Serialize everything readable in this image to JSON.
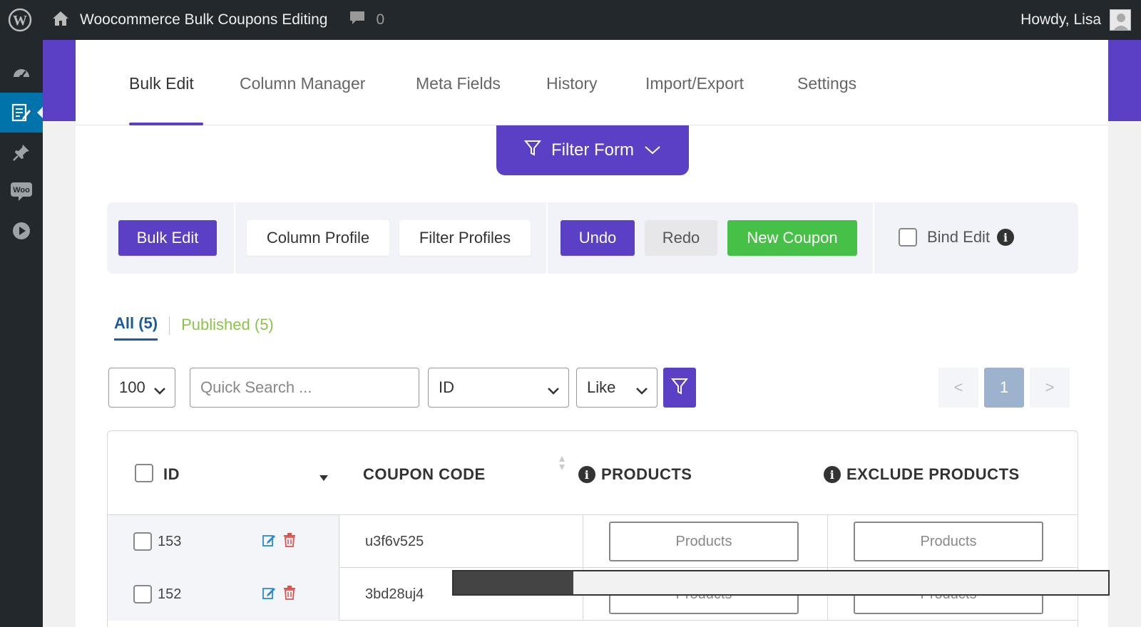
{
  "admin_bar": {
    "site_title": "Woocommerce Bulk Coupons Editing",
    "comments_count": "0",
    "howdy": "Howdy, Lisa"
  },
  "tabs": [
    {
      "label": "Bulk Edit"
    },
    {
      "label": "Column Manager"
    },
    {
      "label": "Meta Fields"
    },
    {
      "label": "History"
    },
    {
      "label": "Import/Export"
    },
    {
      "label": "Settings"
    }
  ],
  "filter_form_label": "Filter Form",
  "toolbar": {
    "bulk_edit": "Bulk Edit",
    "column_profile": "Column Profile",
    "filter_profiles": "Filter Profiles",
    "undo": "Undo",
    "redo": "Redo",
    "new_coupon": "New Coupon",
    "bind_edit": "Bind Edit"
  },
  "status_tabs": {
    "all": "All (5)",
    "published": "Published (5)"
  },
  "filters": {
    "per_page": "100",
    "search_placeholder": "Quick Search ...",
    "field": "ID",
    "operator": "Like"
  },
  "pagination": {
    "prev": "<",
    "current": "1",
    "next": ">"
  },
  "table": {
    "headers": {
      "id": "ID",
      "coupon_code": "COUPON CODE",
      "products": "PRODUCTS",
      "exclude_products": "EXCLUDE PRODUCTS"
    },
    "rows": [
      {
        "id": "153",
        "coupon_code": "u3f6v525",
        "products": "Products",
        "exclude_products": "Products"
      },
      {
        "id": "152",
        "coupon_code": "3bd28uj4",
        "products": "Products",
        "exclude_products": "Products"
      }
    ]
  },
  "colors": {
    "accent": "#5b3fc4",
    "admin_bar": "#23282d",
    "active_menu": "#0073aa",
    "new_coupon": "#46c046",
    "published": "#8bc34a"
  }
}
